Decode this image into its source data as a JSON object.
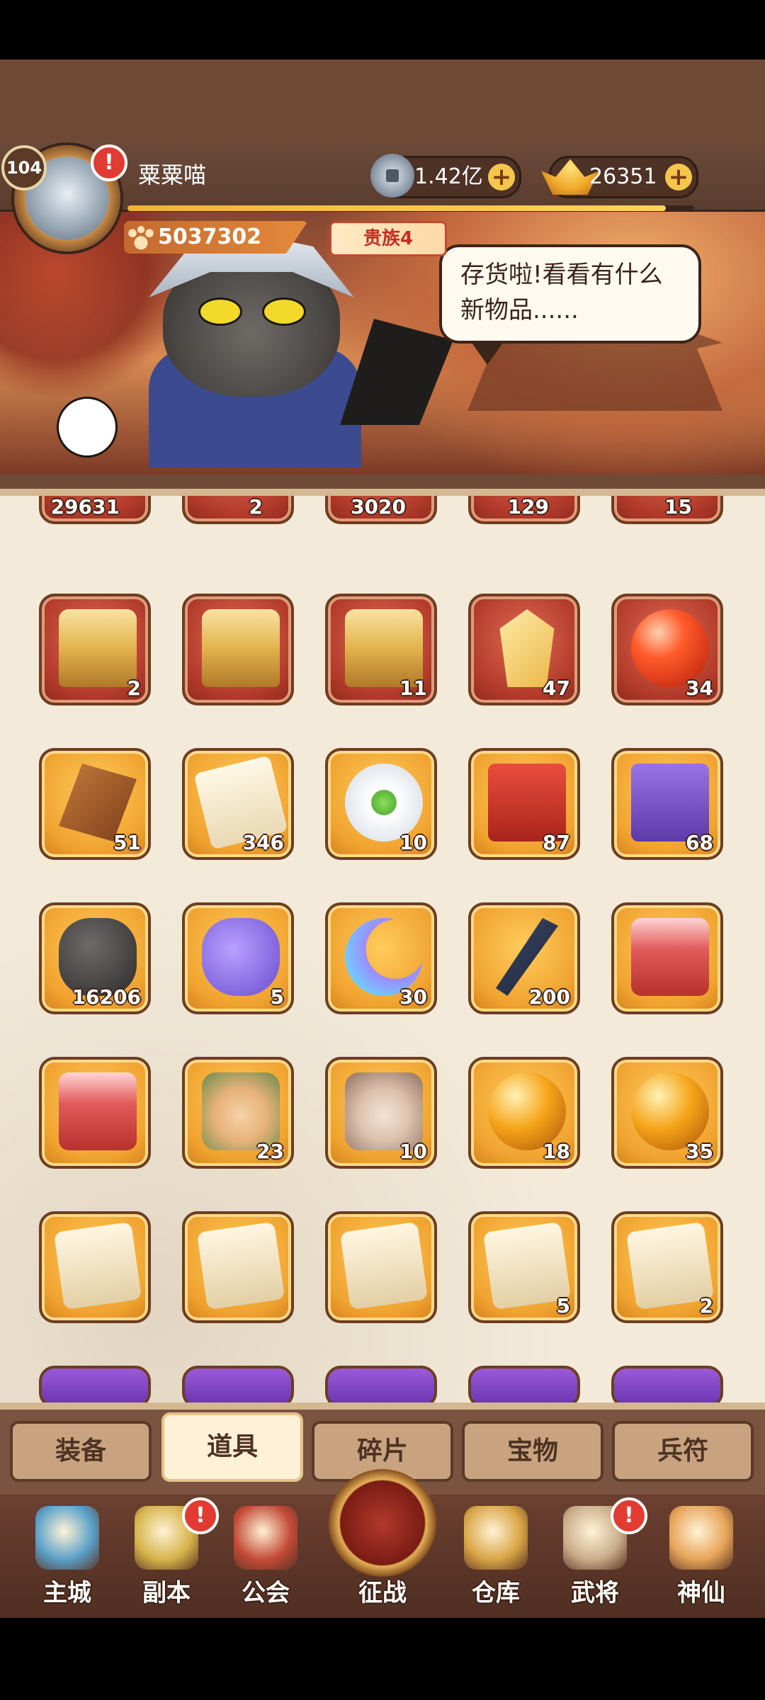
{
  "profile": {
    "level": "104",
    "name": "粟粟喵",
    "power": "5037302",
    "vip": "贵族4",
    "exp_fraction": 0.95,
    "alert": "!"
  },
  "currency": {
    "silver": "1.42亿",
    "gold": "26351",
    "plus": "+"
  },
  "speech": "存货啦!看看有什么新物品......",
  "inventory": {
    "partial_row": [
      "29631",
      "2",
      "3020",
      "129",
      "15"
    ],
    "rows": [
      [
        {
          "name": "gold-chest-pink",
          "count": "2",
          "bg": "red"
        },
        {
          "name": "gold-chest-teal",
          "count": "",
          "bg": "red"
        },
        {
          "name": "gold-chest-blue",
          "count": "11",
          "bg": "red"
        },
        {
          "name": "crystal",
          "count": "47",
          "bg": "red"
        },
        {
          "name": "red-orb",
          "count": "34",
          "bg": "red"
        }
      ],
      [
        {
          "name": "rune-stone",
          "count": "51",
          "bg": "orange"
        },
        {
          "name": "general-scroll",
          "count": "346",
          "bg": "orange"
        },
        {
          "name": "lotus",
          "count": "10",
          "bg": "orange"
        },
        {
          "name": "red-token",
          "count": "87",
          "bg": "orange"
        },
        {
          "name": "purple-token",
          "count": "68",
          "bg": "orange"
        }
      ],
      [
        {
          "name": "dark-stone",
          "count": "16206",
          "bg": "orange"
        },
        {
          "name": "silver-bag",
          "count": "5",
          "bg": "orange"
        },
        {
          "name": "moon-crystal",
          "count": "30",
          "bg": "orange"
        },
        {
          "name": "hook",
          "count": "200",
          "bg": "orange"
        },
        {
          "name": "red-chest",
          "count": "",
          "bg": "orange"
        }
      ],
      [
        {
          "name": "red-chest-2",
          "count": "",
          "bg": "orange"
        },
        {
          "name": "hero-fragment-1",
          "count": "23",
          "bg": "orange"
        },
        {
          "name": "hero-fragment-2",
          "count": "10",
          "bg": "orange"
        },
        {
          "name": "amber-orb-1",
          "count": "18",
          "bg": "orange"
        },
        {
          "name": "amber-orb-2",
          "count": "35",
          "bg": "orange"
        }
      ],
      [
        {
          "name": "paper-scroll-1",
          "count": "",
          "bg": "orange"
        },
        {
          "name": "paper-scroll-2",
          "count": "",
          "bg": "orange"
        },
        {
          "name": "paper-scroll-3",
          "count": "",
          "bg": "orange"
        },
        {
          "name": "paper-scroll-4",
          "count": "5",
          "bg": "orange"
        },
        {
          "name": "paper-scroll-5",
          "count": "2",
          "bg": "orange"
        }
      ]
    ]
  },
  "tabs": [
    "装备",
    "道具",
    "碎片",
    "宝物",
    "兵符"
  ],
  "active_tab": 1,
  "nav": [
    "主城",
    "副本",
    "公会",
    "征战",
    "仓库",
    "武将",
    "神仙"
  ],
  "colors": {
    "accent": "#f0a22f",
    "red_tile": "#b13a2a",
    "alert": "#e23b32"
  }
}
